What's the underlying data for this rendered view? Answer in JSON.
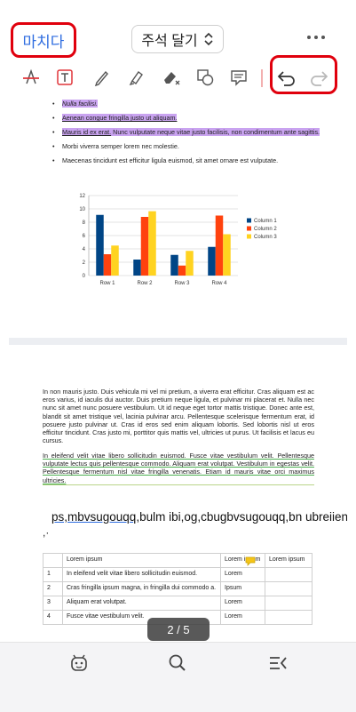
{
  "header": {
    "done_label": "마치다",
    "mode_label": "주석 달기"
  },
  "toolbar": {
    "tools": [
      "strikethrough-icon",
      "text-box-icon",
      "pen-icon",
      "highlighter-icon",
      "eraser-icon",
      "shapes-icon",
      "memo-icon",
      "undo-icon",
      "redo-icon"
    ]
  },
  "document": {
    "bullets": [
      {
        "text": "Nulla facilisi.",
        "highlight": true,
        "italic": true
      },
      {
        "text": "Aenean congue fringilla justo ut aliquam.",
        "highlight": true,
        "italic": false
      },
      {
        "text_a": "Mauris id ex erat.",
        "text_b": " Nunc vulputate neque vitae justo facilisis, non condimentum ante sagittis.",
        "highlight": true
      },
      {
        "text": "Morbi viverra semper lorem nec molestie.",
        "highlight": false
      },
      {
        "text": "Maecenas tincidunt est efficitur ligula euismod, sit amet ornare est vulputate.",
        "highlight": false
      }
    ],
    "paragraph1": "In non mauris justo. Duis vehicula mi vel mi pretium, a viverra erat efficitur. Cras aliquam est ac eros varius, id iaculis dui auctor. Duis pretium neque ligula, et pulvinar mi placerat et. Nulla nec nunc sit amet nunc posuere vestibulum. Ut id neque eget tortor mattis tristique. Donec ante est, blandit sit amet tristique vel, lacinia pulvinar arcu. Pellentesque scelerisque fermentum erat, id posuere justo pulvinar ut. Cras id eros sed enim aliquam lobortis. Sed lobortis nisl ut eros efficitur tincidunt. Cras justo mi, porttitor quis mattis vel, ultricies ut purus. Ut facilisis et lacus eu cursus.",
    "paragraph2": "In eleifend velit vitae libero sollicitudin euismod. Fusce vitae vestibulum velit. Pellentesque vulputate lectus quis pellentesque commodo. Aliquam erat volutpat. Vestibulum in egestas velit. Pellentesque fermentum nisl vitae fringilla venenatis. Etiam id mauris vitae orci maximus ultricies.",
    "big_line_underlined": "ps,mbvsugouqq",
    "big_line_rest": ",bulm ibi,og,cbugbvsugouqq,bn ubreiiene",
    "big_line_2": ",·",
    "table": {
      "header": [
        "",
        "Lorem ipsum",
        "Lorem ipsum",
        "Lorem ipsum"
      ],
      "rows": [
        [
          "1",
          "In eleifend velit vitae libero sollicitudin euismod.",
          "Lorem",
          ""
        ],
        [
          "2",
          "Cras fringilla ipsum magna, in fringilla dui commodo a.",
          "Ipsum",
          ""
        ],
        [
          "3",
          "Aliquam erat volutpat.",
          "Lorem",
          ""
        ],
        [
          "4",
          "Fusce vitae vestibulum velit.",
          "Lorem",
          ""
        ]
      ]
    }
  },
  "chart_data": {
    "type": "bar",
    "categories": [
      "Row 1",
      "Row 2",
      "Row 3",
      "Row 4"
    ],
    "series": [
      {
        "name": "Column 1",
        "values": [
          9.1,
          2.4,
          3.1,
          4.3
        ],
        "color": "#004586"
      },
      {
        "name": "Column 2",
        "values": [
          3.2,
          8.8,
          1.5,
          9.0
        ],
        "color": "#ff420e"
      },
      {
        "name": "Column 3",
        "values": [
          4.5,
          9.65,
          3.7,
          6.2
        ],
        "color": "#ffd320"
      }
    ],
    "yticks": [
      "0",
      "2",
      "4",
      "6",
      "8",
      "10",
      "12"
    ],
    "ylim": [
      0,
      12
    ],
    "grid": true,
    "legend": "right"
  },
  "page_indicator": "2 / 5",
  "bottom_nav": [
    "ai-assistant-icon",
    "search-icon",
    "outline-menu-icon"
  ],
  "colors": {
    "accent": "#2f6de0",
    "highlight_red": "#e0000d",
    "annotation_purple": "#c9a3f0"
  }
}
